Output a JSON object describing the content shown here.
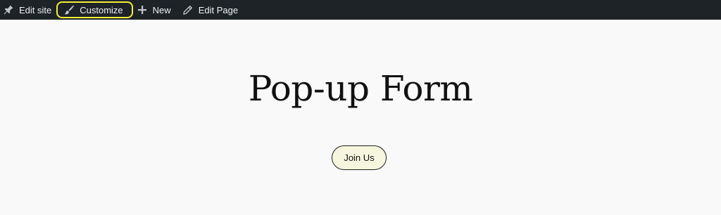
{
  "adminbar": {
    "items": [
      {
        "label": "Edit site",
        "icon": "pin-icon"
      },
      {
        "label": "Customize",
        "icon": "paintbrush-icon"
      },
      {
        "label": "New",
        "icon": "plus-icon"
      },
      {
        "label": "Edit Page",
        "icon": "pencil-icon"
      }
    ],
    "highlight_color": "#f2ee3a",
    "background_color": "#1d2327"
  },
  "main": {
    "title": "Pop-up Form",
    "button_label": "Join Us",
    "button_background": "#f5f6dd"
  }
}
